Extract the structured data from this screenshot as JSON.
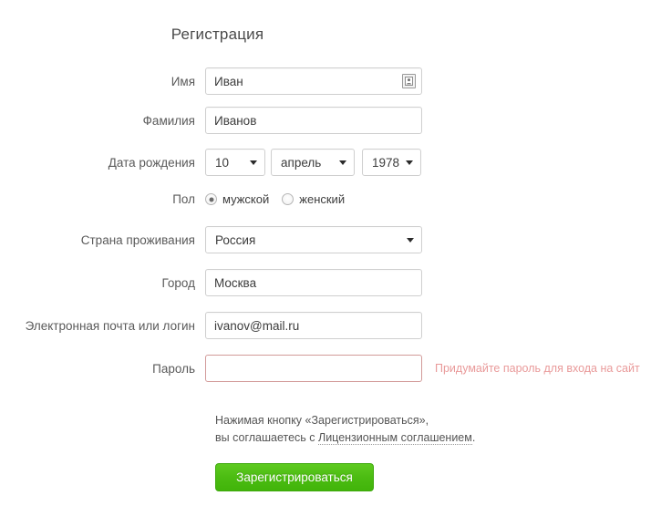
{
  "form": {
    "title": "Регистрация",
    "fields": {
      "first_name": {
        "label": "Имя",
        "value": "Иван",
        "placeholder": "",
        "icon": "contact-card-icon"
      },
      "last_name": {
        "label": "Фамилия",
        "value": "Иванов",
        "placeholder": ""
      },
      "birth_date": {
        "label": "Дата рождения",
        "day": "10",
        "month": "апрель",
        "year": "1978"
      },
      "gender": {
        "label": "Пол",
        "options": [
          {
            "label": "мужской",
            "selected": true
          },
          {
            "label": "женский",
            "selected": false
          }
        ]
      },
      "country": {
        "label": "Страна проживания",
        "value": "Россия"
      },
      "city": {
        "label": "Город",
        "value": "Москва",
        "placeholder": ""
      },
      "email": {
        "label": "Электронная почта или логин",
        "value": "ivanov@mail.ru",
        "placeholder": ""
      },
      "password": {
        "label": "Пароль",
        "value": "",
        "placeholder": "",
        "hint": "Придумайте пароль для входа на сайт"
      }
    },
    "agreement": {
      "line1": "Нажимая кнопку «Зарегистрироваться»,",
      "line2_prefix": "вы соглашаетесь с ",
      "link_text": "Лицензионным соглашением",
      "line2_suffix": "."
    },
    "submit_label": "Зарегистрироваться"
  },
  "colors": {
    "accent_green": "#4cbc12",
    "error_red": "#e99a9a",
    "error_border": "#d29a99",
    "label_gray": "#5a5a5a",
    "border_gray": "#cfcfcf"
  }
}
